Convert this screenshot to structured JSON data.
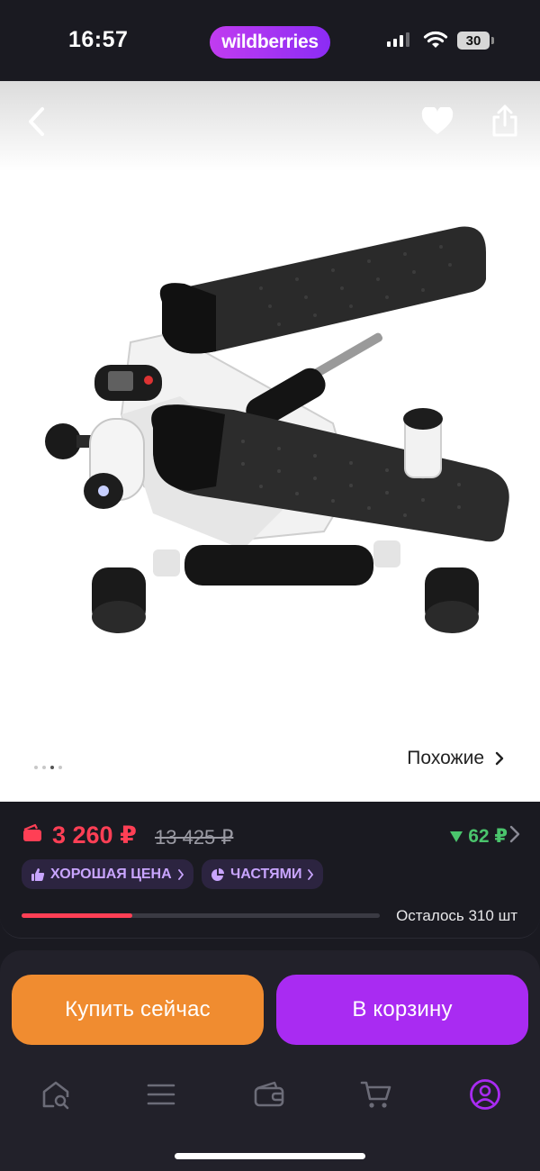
{
  "status_bar": {
    "time": "16:57",
    "brand": "wildberries",
    "battery": "30"
  },
  "product": {
    "similar_label": "Похожие",
    "gallery_pages": 4,
    "gallery_active_index": 2
  },
  "price": {
    "current": "3 260 ₽",
    "old": "13 425 ₽",
    "cashback": "62 ₽",
    "badges": [
      {
        "label": "ХОРОШАЯ ЦЕНА",
        "icon": "thumbs-up-icon"
      },
      {
        "label": "ЧАСТЯМИ",
        "icon": "pie-chart-icon"
      }
    ],
    "stock_label": "Осталось 310 шт",
    "stock_fraction": 0.31
  },
  "actions": {
    "buy_now": "Купить сейчас",
    "add_to_cart": "В корзину"
  },
  "tabbar": {
    "items": [
      "home-search-icon",
      "catalog-menu-icon",
      "wallet-icon",
      "cart-icon",
      "profile-icon"
    ],
    "active": 4
  },
  "colors": {
    "accent_purple": "#a92bf2",
    "buy_orange": "#f08c30",
    "price_red": "#ff3f55",
    "cashback_green": "#4ac46c",
    "background": "#1a1a21"
  }
}
